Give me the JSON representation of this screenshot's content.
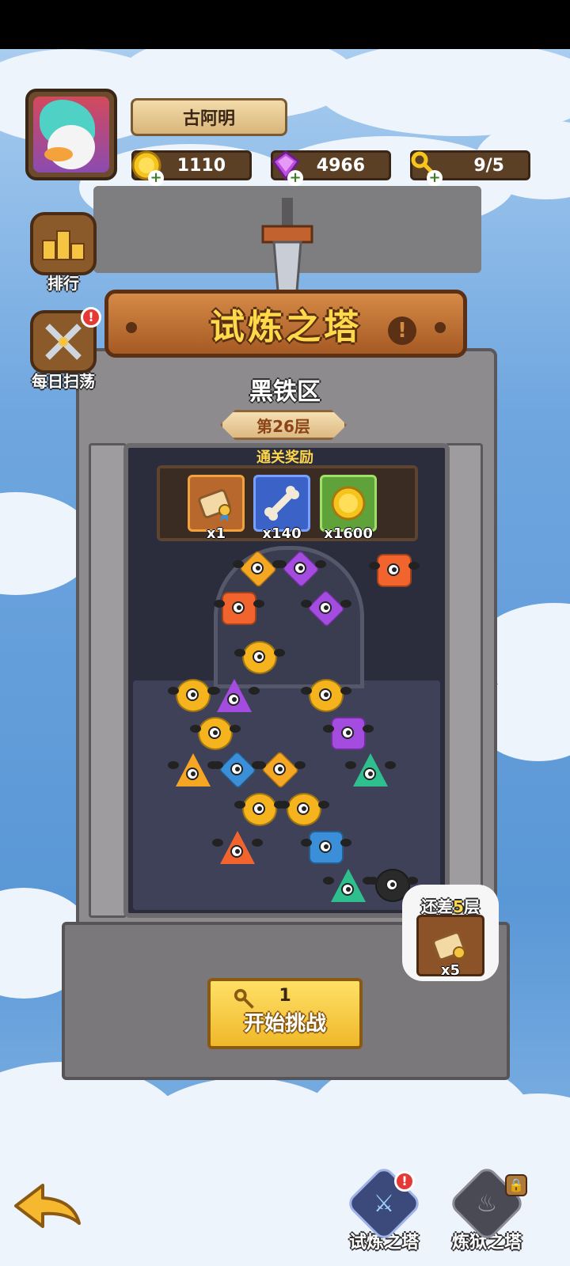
{
  "player": {
    "name": "古阿明",
    "avatar": "duck-avatar"
  },
  "resources": {
    "gold": "1110",
    "gems": "4966",
    "keys": "9/5"
  },
  "side_buttons": {
    "ranking": {
      "label": "排行",
      "icon": "podium-icon"
    },
    "sweep": {
      "label": "每日扫荡",
      "icon": "crossed-swords-icon",
      "alert": "!"
    }
  },
  "banner": {
    "title": "试炼之塔",
    "info": "!"
  },
  "zone": {
    "name": "黑铁区",
    "floor": "第26层"
  },
  "rewards": {
    "title": "通关奖励",
    "items": [
      {
        "icon": "scroll-icon",
        "count": "x1",
        "color": "#b8682c"
      },
      {
        "icon": "bone-icon",
        "count": "x140",
        "color": "#3b62c7"
      },
      {
        "icon": "gold-coin-icon",
        "count": "x1600",
        "color": "#5fa23a"
      }
    ]
  },
  "bubble": {
    "prefix": "还差",
    "number": "5",
    "suffix": "层",
    "item_icon": "scroll-icon",
    "count": "x5"
  },
  "start_button": {
    "cost": "1",
    "label": "开始挑战"
  },
  "nav": {
    "back_icon": "back-arrow-icon",
    "tabs": [
      {
        "label": "试炼之塔",
        "icon": "tower-sword-icon",
        "alert": "!"
      },
      {
        "label": "炼狱之塔",
        "icon": "inferno-tower-icon",
        "locked": true
      }
    ]
  },
  "colors": {
    "accent": "#ffd94a",
    "banner": "#c4733a",
    "alert": "#e53935"
  }
}
